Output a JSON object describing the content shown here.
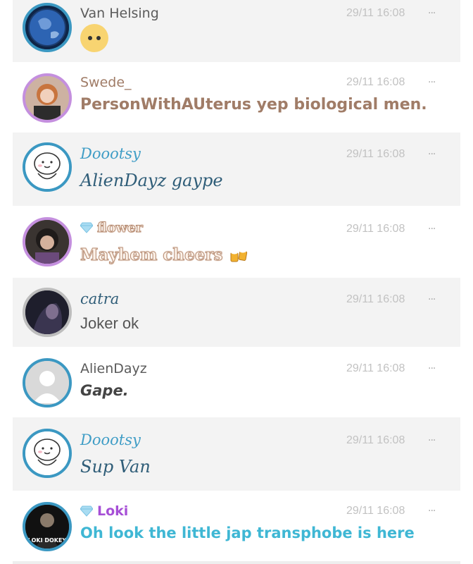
{
  "messages": [
    {
      "name": "Van Helsing",
      "time": "29/11 16:08",
      "text": "",
      "emoji": "neutral-face",
      "name_color": "#5b5b5b",
      "text_color": "#5b5b5b",
      "avatar_ring": "#3b98c2"
    },
    {
      "name": "Swede_",
      "time": "29/11 16:08",
      "text": "PersonWithAUterus yep biological men.",
      "name_color": "#a07c67",
      "text_color": "#a07c67",
      "avatar_ring": "#c48fde"
    },
    {
      "name": "Doootsy",
      "time": "29/11 16:08",
      "text": "AlienDayz gaype",
      "name_color": "#3f9dc6",
      "text_color": "#2f5d78",
      "avatar_ring": "#3b98c2"
    },
    {
      "name": "flower",
      "time": "29/11 16:08",
      "text": "Mayhem cheers",
      "badge": "diamond-icon",
      "emoji": "beer-mugs",
      "name_color": "#b78d74",
      "text_color": "#fdf3ea",
      "avatar_ring": "#c48fde"
    },
    {
      "name": "catra",
      "time": "29/11 16:08",
      "text": "Joker ok",
      "name_color": "#2f5d78",
      "text_color": "#555555",
      "avatar_ring": "#bdbdbd"
    },
    {
      "name": "AlienDayz",
      "time": "29/11 16:08",
      "text": "Gape.",
      "name_color": "#5b5b5b",
      "text_color": "#444444",
      "avatar_ring": "#3b98c2"
    },
    {
      "name": "Doootsy",
      "time": "29/11 16:08",
      "text": "Sup Van",
      "name_color": "#3f9dc6",
      "text_color": "#2f5d78",
      "avatar_ring": "#3b98c2"
    },
    {
      "name": "Loki",
      "time": "29/11 16:08",
      "text": "Oh look the little jap transphobe is here",
      "badge": "diamond-icon",
      "avatar_caption": "LOKI DOKEY",
      "name_color": "#a64fd6",
      "text_color": "#3fb7d4",
      "avatar_ring": "#3b98c2"
    }
  ],
  "more_label": "···"
}
